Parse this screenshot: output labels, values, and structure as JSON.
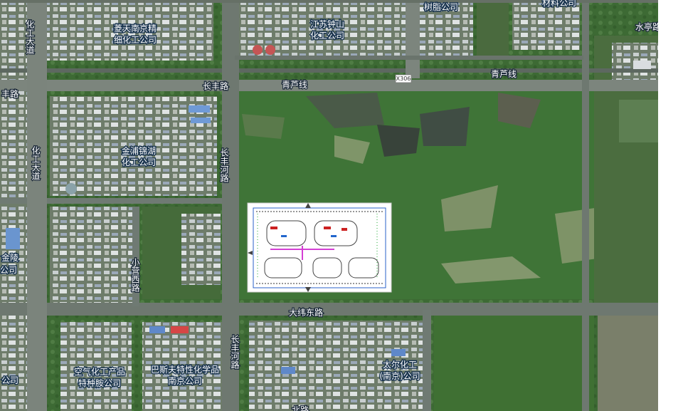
{
  "map": {
    "roads": {
      "changfeng_road_horizontal": "长丰路",
      "qinglu_line_west": "青芦线",
      "qinglu_line_east": "青芦线",
      "route_shield": "X306",
      "changfeng_river_road_north": "长丰河路",
      "changfeng_river_road_south": "长丰河路",
      "huagong_avenue_north": "化工大道",
      "huagong_avenue_mid": "化工大道",
      "fengrui_road_left": "丰路",
      "daweidong_road": "大纬东路",
      "xiaohexi_road": "小营西路",
      "bottom_road_partial": "北路",
      "shuiyu_road_partial": "水亭路"
    },
    "pois": {
      "lingtian": "菱天南京精细化工公司",
      "lingtian_line1": "菱天南京精",
      "lingtian_line2": "细化工公司",
      "jiangsu_zhongshan_line1": "江苏钟山",
      "jiangsu_zhongshan_line2": "化工公司",
      "resin": "树脂公司",
      "materials": "材料公司",
      "jinpu_line1": "金浦锦湖",
      "jinpu_line2": "化工公司",
      "jinling_line1": "金陵",
      "jinling_line2": "公司",
      "air_line1": "空气化工产品",
      "air_line2": "特种胺公司",
      "basf_line1": "巴斯夫特性化学品",
      "basf_line2": "南京公司",
      "taier_line1": "太尔化工",
      "taier_line2": "(南京)公司",
      "left_bottom": "公司"
    },
    "overlay": {
      "kind": "site-plan",
      "description_visible": false
    }
  }
}
